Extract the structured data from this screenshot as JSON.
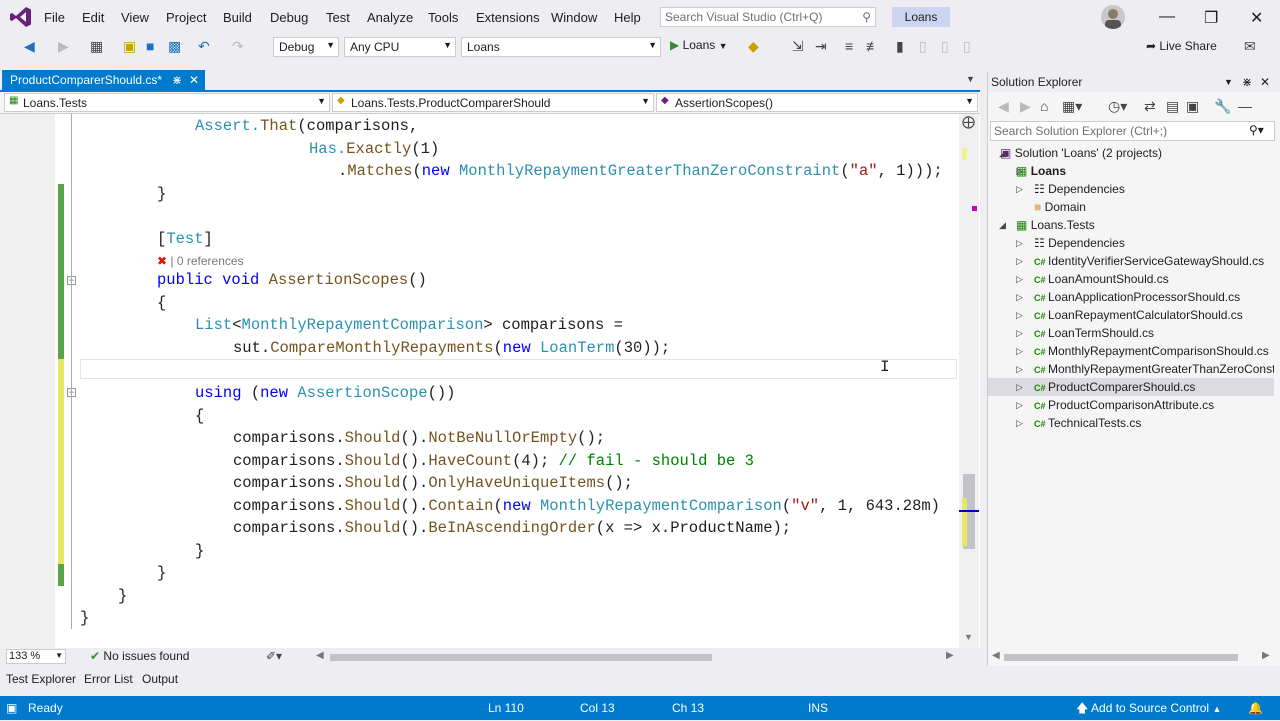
{
  "menu": [
    "File",
    "Edit",
    "View",
    "Project",
    "Build",
    "Debug",
    "Test",
    "Analyze",
    "Tools",
    "Extensions",
    "Window",
    "Help"
  ],
  "search": {
    "placeholder": "Search Visual Studio (Ctrl+Q)"
  },
  "solution_badge": "Loans",
  "toolbar": {
    "config": "Debug",
    "platform": "Any CPU",
    "project": "Loans",
    "run_label": "Loans",
    "live_share": "Live Share"
  },
  "tab": {
    "title": "ProductComparerShould.cs*"
  },
  "navbar": {
    "project": "Loans.Tests",
    "class": "Loans.Tests.ProductComparerShould",
    "member": "AssertionScopes()"
  },
  "code": {
    "l1a": "Assert.",
    "l1b": "That",
    "l1c": "(comparisons,",
    "l2a": "Has.",
    "l2b": "Exactly",
    "l2c": "(1)",
    "l3a": ".",
    "l3b": "Matches",
    "l3c": "(",
    "l3d": "new",
    "l3e": " ",
    "l3f": "MonthlyRepaymentGreaterThanZeroConstraint",
    "l3g": "(",
    "l3h": "\"a\"",
    "l3i": ", 1)));",
    "l4": "}",
    "l5a": "[",
    "l5b": "Test",
    "l5c": "]",
    "lens": "0 references",
    "l6a": "public",
    "l6b": " ",
    "l6c": "void",
    "l6d": " ",
    "l6e": "AssertionScopes",
    "l6f": "()",
    "l7": "{",
    "l8a": "List",
    "l8b": "<",
    "l8c": "MonthlyRepaymentComparison",
    "l8d": "> comparisons =",
    "l9a": "sut.",
    "l9b": "CompareMonthlyRepayments",
    "l9c": "(",
    "l9d": "new",
    "l9e": " ",
    "l9f": "LoanTerm",
    "l9g": "(30));",
    "l11a": "using",
    "l11b": " (",
    "l11c": "new",
    "l11d": " ",
    "l11e": "AssertionScope",
    "l11f": "())",
    "l12": "{",
    "l13a": "comparisons.",
    "l13b": "Should",
    "l13c": "().",
    "l13d": "NotBeNullOrEmpty",
    "l13e": "();",
    "l14a": "comparisons.",
    "l14b": "Should",
    "l14c": "().",
    "l14d": "HaveCount",
    "l14e": "(4); ",
    "l14f": "// fail - should be 3",
    "l15a": "comparisons.",
    "l15b": "Should",
    "l15c": "().",
    "l15d": "OnlyHaveUniqueItems",
    "l15e": "();",
    "l16a": "comparisons.",
    "l16b": "Should",
    "l16c": "().",
    "l16d": "Contain",
    "l16e": "(",
    "l16f": "new",
    "l16g": " ",
    "l16h": "MonthlyRepaymentComparison",
    "l16i": "(",
    "l16j": "\"v\"",
    "l16k": ", 1, 643.28m)",
    "l17a": "comparisons.",
    "l17b": "Should",
    "l17c": "().",
    "l17d": "BeInAscendingOrder",
    "l17e": "(x => x.ProductName);",
    "l18": "}",
    "l19": "}",
    "l20": "}",
    "l21": "}"
  },
  "editor_status": {
    "zoom": "133 %",
    "issues": "No issues found"
  },
  "solution_explorer": {
    "title": "Solution Explorer",
    "search_placeholder": "Search Solution Explorer (Ctrl+;)",
    "items": [
      "Solution 'Loans' (2 projects)",
      "Loans",
      "Dependencies",
      "Domain",
      "Loans.Tests",
      "Dependencies",
      "IdentityVerifierServiceGatewayShould.cs",
      "LoanAmountShould.cs",
      "LoanApplicationProcessorShould.cs",
      "LoanRepaymentCalculatorShould.cs",
      "LoanTermShould.cs",
      "MonthlyRepaymentComparisonShould.cs",
      "MonthlyRepaymentGreaterThanZeroConstraintShould.cs",
      "ProductComparerShould.cs",
      "ProductComparisonAttribute.cs",
      "TechnicalTests.cs"
    ]
  },
  "bottom_tabs": [
    "Test Explorer",
    "Error List",
    "Output"
  ],
  "status": {
    "ready": "Ready",
    "ln": "Ln 110",
    "col": "Col 13",
    "ch": "Ch 13",
    "ins": "INS",
    "source_control": "Add to Source Control"
  },
  "colors": {
    "accent": "#007acc",
    "keyword": "#0000ff",
    "type": "#2b91af",
    "string": "#a31515",
    "comment": "#008000"
  }
}
